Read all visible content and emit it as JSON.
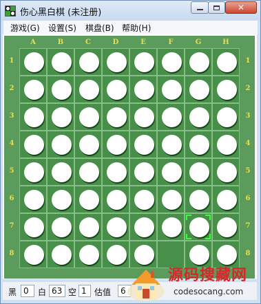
{
  "window": {
    "title": "伤心黑白棋 (未注册)",
    "controls": {
      "close": "✕"
    }
  },
  "menu": {
    "items": [
      {
        "label": "游戏(G)"
      },
      {
        "label": "设置(S)"
      },
      {
        "label": "棋盘(B)"
      },
      {
        "label": "帮助(H)"
      }
    ]
  },
  "board": {
    "columns": [
      "A",
      "B",
      "C",
      "D",
      "E",
      "F",
      "G",
      "H"
    ],
    "rows": [
      "1",
      "2",
      "3",
      "4",
      "5",
      "6",
      "7",
      "8"
    ],
    "colors": {
      "felt": "#4a924a",
      "frame": "#5b9b5b",
      "grid": "#86bf86",
      "coords": "#e8df57",
      "cursor": "#35ff35"
    },
    "cells": [
      [
        "white",
        "white",
        "white",
        "white",
        "white",
        "white",
        "white",
        "white"
      ],
      [
        "white",
        "white",
        "white",
        "white",
        "white",
        "white",
        "white",
        "white"
      ],
      [
        "white",
        "white",
        "white",
        "white",
        "white",
        "white",
        "white",
        "white"
      ],
      [
        "white",
        "white",
        "white",
        "white",
        "white",
        "white",
        "white",
        "white"
      ],
      [
        "white",
        "white",
        "white",
        "white",
        "white",
        "white",
        "white",
        "white"
      ],
      [
        "white",
        "white",
        "white",
        "white",
        "white",
        "white",
        "white",
        "white"
      ],
      [
        "white",
        "white",
        "white",
        "white",
        "white",
        "white",
        "white",
        "white"
      ],
      [
        "white",
        "white",
        "white",
        "white",
        "white",
        "empty",
        "white",
        "white"
      ]
    ],
    "cursor": {
      "column": "G",
      "row": "7"
    }
  },
  "status": {
    "black_label": "黑",
    "black_count": "0",
    "white_label": "白",
    "white_count": "63",
    "empty_label": "空",
    "empty_count": "1",
    "eval_label": "估值",
    "eval_value": "6"
  },
  "watermark": {
    "title": "源码搜藏网",
    "url": "codesocang.com"
  }
}
